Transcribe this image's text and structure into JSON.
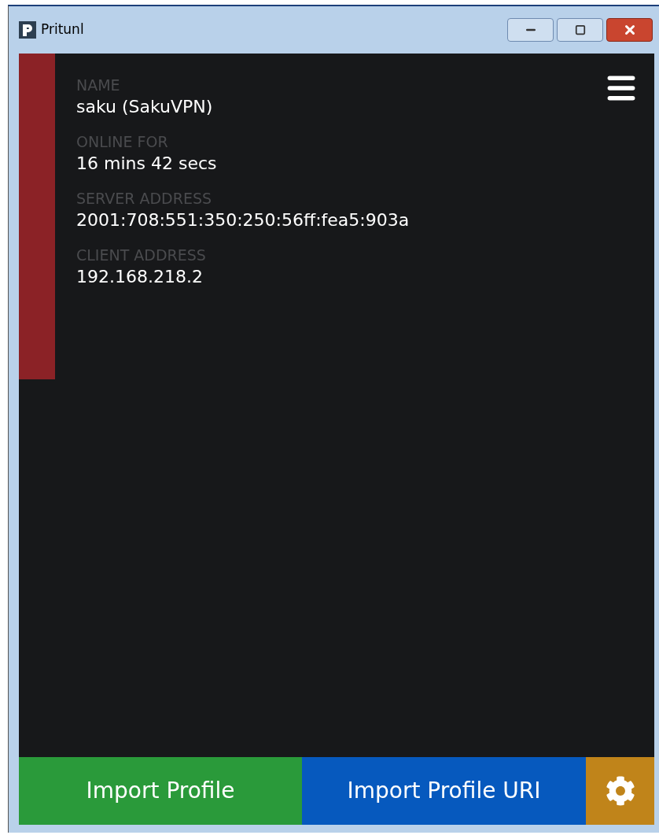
{
  "window": {
    "title": "Pritunl"
  },
  "profile": {
    "color": "#8b2226",
    "fields": [
      {
        "label": "NAME",
        "value": "saku (SakuVPN)"
      },
      {
        "label": "ONLINE FOR",
        "value": "16 mins 42 secs"
      },
      {
        "label": "SERVER ADDRESS",
        "value": "2001:708:551:350:250:56ff:fea5:903a"
      },
      {
        "label": "CLIENT ADDRESS",
        "value": "192.168.218.2"
      }
    ]
  },
  "buttons": [
    {
      "label": "Import Profile",
      "kind": "import"
    },
    {
      "label": "Import Profile URI",
      "kind": "uri"
    },
    {
      "kind": "settings"
    }
  ]
}
